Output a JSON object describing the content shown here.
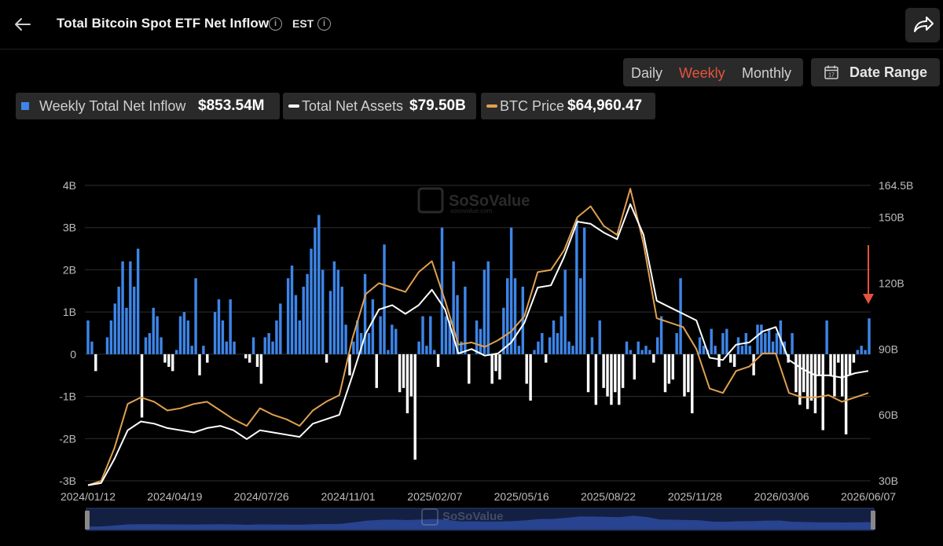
{
  "header": {
    "title": "Total Bitcoin Spot ETF Net Inflow",
    "timezone": "EST"
  },
  "controls": {
    "periods": [
      "Daily",
      "Weekly",
      "Monthly"
    ],
    "active_period": "Weekly",
    "date_range_label": "Date Range"
  },
  "legend": [
    {
      "name": "Weekly Total Net Inflow",
      "value": "$853.54M",
      "color": "#3d85e8"
    },
    {
      "name": "Total Net Assets",
      "value": "$79.50B",
      "color": "#ffffff"
    },
    {
      "name": "BTC Price",
      "value": "$64,960.47",
      "color": "#e0a050"
    }
  ],
  "watermark": {
    "brand": "SoSoValue",
    "site": "sosovalue.com"
  },
  "colors": {
    "positive_bar": "#3d85e8",
    "negative_bar": "#ffffff",
    "price_line": "#e0a050",
    "assets_line": "#ffffff",
    "marker_arrow": "#e5533d"
  },
  "chart_data": {
    "type": "bar",
    "x_tick_labels": [
      "2024/01/12",
      "2024/04/19",
      "2024/07/26",
      "2024/11/01",
      "2025/02/07",
      "2025/05/16",
      "2025/08/22",
      "2025/11/28",
      "2026/03/06",
      "2026/06/07"
    ],
    "left_axis": {
      "ticks": [
        "-3B",
        "-2B",
        "-1B",
        "0",
        "1B",
        "2B",
        "3B",
        "4B"
      ],
      "range": [
        -3,
        4
      ],
      "unit": "B USD"
    },
    "right_axis": {
      "ticks": [
        "30B",
        "60B",
        "90B",
        "120B",
        "150B",
        "164.5B"
      ],
      "range": [
        30,
        164.5
      ],
      "unit": "B USD"
    },
    "grid": "horizontal",
    "series": [
      {
        "name": "Weekly Total Net Inflow",
        "axis": "left",
        "kind": "bar",
        "values": [
          0.8,
          0.3,
          -0.4,
          0,
          0,
          0.4,
          0.8,
          1.2,
          1.6,
          2.2,
          1.1,
          2.2,
          1.6,
          2.5,
          -1.5,
          0.4,
          0.5,
          1.1,
          0.9,
          0.4,
          -0.2,
          -0.3,
          -0.4,
          0.1,
          0.9,
          1.0,
          0.8,
          0.2,
          1.8,
          -0.5,
          0.2,
          -0.2,
          0,
          1.0,
          1.3,
          0.8,
          0.3,
          1.3,
          0.3,
          0,
          0,
          -0.1,
          -0.2,
          0.4,
          -0.3,
          -0.7,
          0.4,
          0.5,
          0.3,
          0.8,
          1.2,
          0,
          1.8,
          2.1,
          1.4,
          0.8,
          1.6,
          1.9,
          2.5,
          3.0,
          3.3,
          2.0,
          -0.2,
          1.5,
          2.2,
          2.0,
          1.6,
          0.7,
          -0.5,
          0.3,
          0.8,
          0.5,
          1.9,
          0.5,
          1.3,
          -0.8,
          0.9,
          2.6,
          0.1,
          0.7,
          0.6,
          -0.9,
          -0.8,
          -1.4,
          -1.0,
          -2.5,
          0.3,
          0.9,
          0.2,
          0.9,
          0.1,
          -0.3,
          3.0,
          0.9,
          0.8,
          2.2,
          1.4,
          0.3,
          1.6,
          -0.7,
          0,
          0.8,
          0.6,
          2.0,
          2.2,
          -0.7,
          -0.4,
          -0.6,
          1.1,
          1.8,
          3.0,
          1.8,
          0.2,
          1.6,
          -0.7,
          -1.1,
          0.1,
          0.3,
          0.5,
          -0.2,
          0.4,
          0.8,
          0.5,
          0.9,
          2.0,
          0.3,
          0.2,
          3.2,
          1.8,
          3.0,
          -0.9,
          0.4,
          -1.2,
          0.8,
          -0.8,
          -1.0,
          -1.2,
          -0.9,
          -1.2,
          -0.8,
          0.3,
          0.1,
          -0.6,
          0.3,
          0.1,
          0.2,
          0.1,
          -0.2,
          0.4,
          0.9,
          -0.9,
          -0.7,
          -0.6,
          0.5,
          1.8,
          -1.0,
          -0.9,
          -1.4,
          0,
          0.4,
          0.2,
          0.1,
          0.6,
          0.2,
          -0.3,
          0.5,
          0.6,
          -0.2,
          -0.3,
          0.4,
          0.2,
          0.5,
          0.2,
          -0.5,
          0.7,
          0.7,
          0.5,
          0.6,
          0.3,
          0.5,
          0.8,
          0.3,
          -0.2,
          0.5,
          -0.9,
          -1.2,
          -0.9,
          -1.3,
          -1.1,
          -1.4,
          -0.5,
          -1.8,
          0.8,
          -0.5,
          -1.0,
          -0.2,
          -1.0,
          -1.9,
          -0.5,
          -0.2,
          0.1,
          0.2,
          0.1,
          0.85
        ]
      },
      {
        "name": "Total Net Assets",
        "axis": "right",
        "kind": "line",
        "x_frac": [
          0,
          0.02,
          0.04,
          0.06,
          0.08,
          0.1,
          0.12,
          0.14,
          0.16,
          0.18,
          0.2,
          0.22,
          0.24,
          0.26,
          0.28,
          0.3,
          0.32,
          0.34,
          0.36,
          0.38,
          0.4,
          0.42,
          0.44,
          0.46,
          0.48,
          0.5,
          0.52,
          0.54,
          0.56,
          0.58,
          0.6,
          0.62,
          0.64,
          0.66,
          0.68,
          0.7,
          0.72,
          0.74,
          0.76,
          0.78,
          0.8,
          0.82,
          0.84,
          0.86,
          0.88,
          0.9,
          0.92,
          0.94,
          0.96,
          0.98,
          1.0
        ],
        "values": [
          28,
          29,
          40,
          53,
          57,
          56,
          54,
          53,
          52,
          54,
          55,
          53,
          49,
          53,
          52,
          51,
          50,
          56,
          58,
          60,
          78,
          97,
          108,
          110,
          106,
          110,
          117,
          108,
          88,
          90,
          87,
          88,
          93,
          102,
          118,
          119,
          132,
          148,
          147,
          143,
          140,
          156,
          142,
          112,
          109,
          106,
          103,
          86,
          85,
          92,
          93,
          98,
          100,
          85,
          81,
          78,
          78,
          77,
          79,
          80
        ]
      },
      {
        "name": "BTC Price",
        "axis": "right",
        "kind": "line",
        "values": [
          28,
          30,
          45,
          65,
          68,
          66,
          62,
          63,
          65,
          66,
          62,
          58,
          55,
          63,
          60,
          58,
          55,
          62,
          66,
          69,
          95,
          115,
          120,
          118,
          116,
          125,
          130,
          112,
          92,
          93,
          91,
          94,
          98,
          105,
          125,
          126,
          135,
          150,
          155,
          146,
          142,
          163,
          138,
          104,
          102,
          100,
          90,
          72,
          70,
          80,
          82,
          88,
          88,
          70,
          68,
          68,
          69,
          66,
          68,
          70
        ]
      }
    ]
  }
}
